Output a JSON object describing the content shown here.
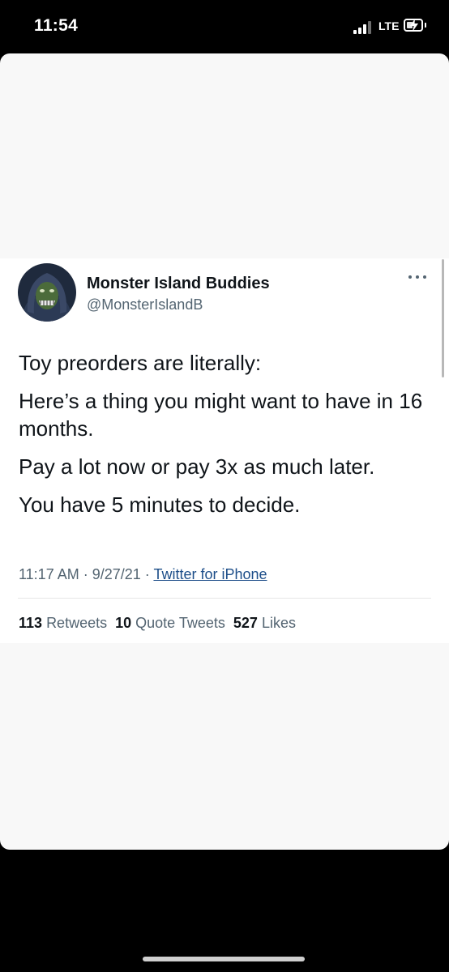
{
  "status_bar": {
    "time": "11:54",
    "network": "LTE"
  },
  "tweet": {
    "display_name": "Monster Island Buddies",
    "handle": "@MonsterIslandB",
    "lines": [
      "Toy preorders are literally:",
      "Here’s a thing you might want to have in 16 months.",
      "Pay a lot now or pay 3x as much later.",
      "You have 5 minutes to decide."
    ],
    "time": "11:17 AM",
    "separator": " · ",
    "date": "9/27/21",
    "source": "Twitter for iPhone",
    "stats": {
      "retweets_count": "113",
      "retweets_label": "Retweets",
      "quotes_count": "10",
      "quotes_label": "Quote Tweets",
      "likes_count": "527",
      "likes_label": "Likes"
    }
  },
  "icons": {
    "more": "more-options-icon",
    "signal": "cellular-signal-icon",
    "battery": "battery-charging-icon"
  },
  "colors": {
    "text": "#0f1419",
    "secondary": "#536471",
    "link": "#1d4e89",
    "background": "#000000"
  }
}
